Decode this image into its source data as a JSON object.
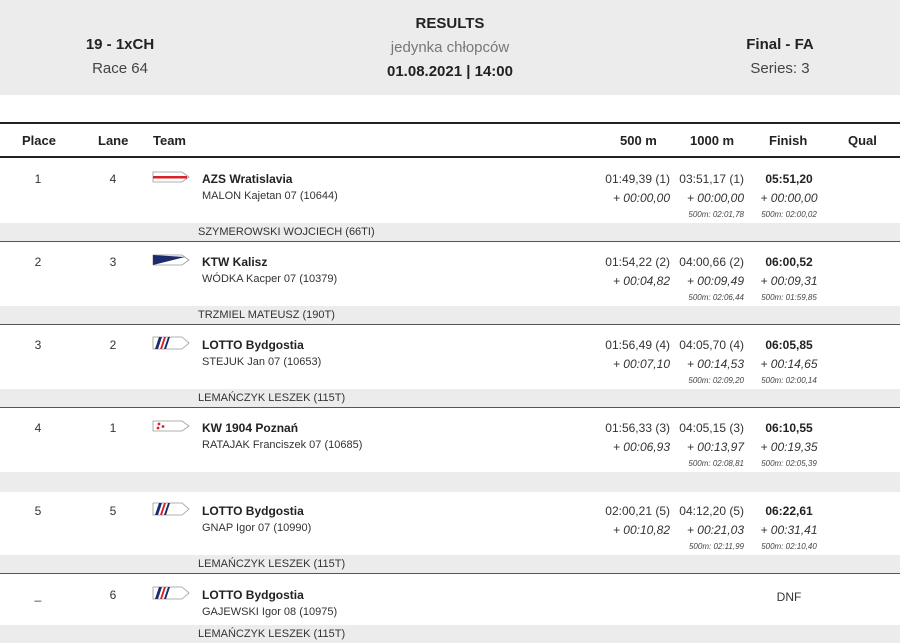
{
  "header": {
    "event_code": "19 - 1xCH",
    "race": "Race 64",
    "title": "RESULTS",
    "subtitle": "jedynka chłopców",
    "datetime": "01.08.2021 | 14:00",
    "phase": "Final - FA",
    "series": "Series: 3"
  },
  "columns": {
    "place": "Place",
    "lane": "Lane",
    "team": "Team",
    "t500": "500 m",
    "t1000": "1000 m",
    "finish": "Finish",
    "qual": "Qual"
  },
  "rows": [
    {
      "place": "1",
      "lane": "4",
      "flag": "azs",
      "team": "AZS Wratislavia",
      "crew": "MALON  Kajetan 07 (10644)",
      "t500": "01:49,39 (1)",
      "t500_diff": "+ 00:00,00",
      "t1000": "03:51,17 (1)",
      "t1000_diff": "+ 00:00,00",
      "t1000_split": "500m: 02:01,78",
      "finish": "05:51,20",
      "finish_diff": "+ 00:00,00",
      "finish_split": "500m: 02:00,02",
      "coach": "SZYMEROWSKI WOJCIECH (66TI)"
    },
    {
      "place": "2",
      "lane": "3",
      "flag": "ktw",
      "team": "KTW Kalisz",
      "crew": "WÓDKA  Kacper 07 (10379)",
      "t500": "01:54,22 (2)",
      "t500_diff": "+ 00:04,82",
      "t1000": "04:00,66 (2)",
      "t1000_diff": "+ 00:09,49",
      "t1000_split": "500m: 02:06,44",
      "finish": "06:00,52",
      "finish_diff": "+ 00:09,31",
      "finish_split": "500m: 01:59,85",
      "coach": "TRZMIEL MATEUSZ (190T)"
    },
    {
      "place": "3",
      "lane": "2",
      "flag": "lotto",
      "team": "LOTTO Bydgostia",
      "crew": "STEJUK  Jan 07 (10653)",
      "t500": "01:56,49 (4)",
      "t500_diff": "+ 00:07,10",
      "t1000": "04:05,70 (4)",
      "t1000_diff": "+ 00:14,53",
      "t1000_split": "500m: 02:09,20",
      "finish": "06:05,85",
      "finish_diff": "+ 00:14,65",
      "finish_split": "500m: 02:00,14",
      "coach": "LEMAŃCZYK LESZEK (115T)"
    },
    {
      "place": "4",
      "lane": "1",
      "flag": "kw",
      "team": "KW 1904 Poznań",
      "crew": "RATAJAK  Franciszek 07 (10685)",
      "t500": "01:56,33 (3)",
      "t500_diff": "+ 00:06,93",
      "t1000": "04:05,15 (3)",
      "t1000_diff": "+ 00:13,97",
      "t1000_split": "500m: 02:08,81",
      "finish": "06:10,55",
      "finish_diff": "+ 00:19,35",
      "finish_split": "500m: 02:05,39",
      "coach": ""
    },
    {
      "place": "5",
      "lane": "5",
      "flag": "lotto",
      "team": "LOTTO Bydgostia",
      "crew": "GNAP  Igor 07 (10990)",
      "t500": "02:00,21 (5)",
      "t500_diff": "+ 00:10,82",
      "t1000": "04:12,20 (5)",
      "t1000_diff": "+ 00:21,03",
      "t1000_split": "500m: 02:11,99",
      "finish": "06:22,61",
      "finish_diff": "+ 00:31,41",
      "finish_split": "500m: 02:10,40",
      "coach": "LEMAŃCZYK LESZEK (115T)"
    },
    {
      "place": "_",
      "lane": "6",
      "flag": "lotto",
      "team": "LOTTO Bydgostia",
      "crew": "GAJEWSKI  Igor 08 (10975)",
      "t500": "",
      "t500_diff": "",
      "t1000": "",
      "t1000_diff": "",
      "t1000_split": "",
      "finish": "DNF",
      "finish_diff": "",
      "finish_split": "",
      "coach": "LEMAŃCZYK LESZEK (115T)"
    }
  ]
}
